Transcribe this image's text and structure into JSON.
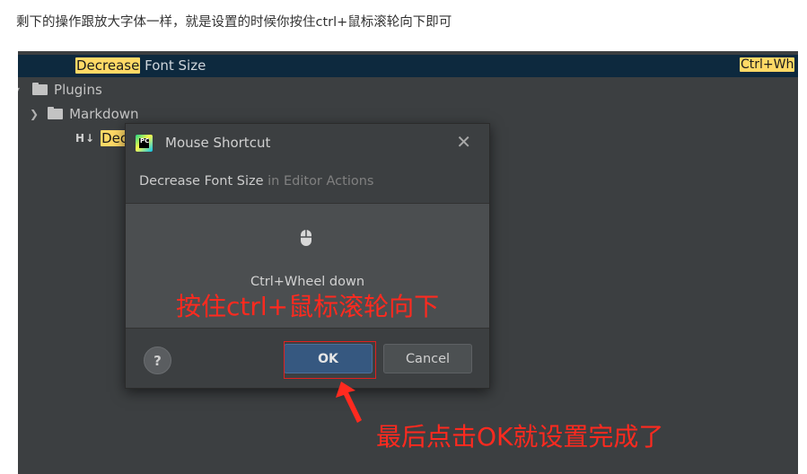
{
  "article": {
    "text": "剩下的操作跟放大字体一样，就是设置的时候你按住ctrl+鼠标滚轮向下即可"
  },
  "keymap": {
    "selected_highlight": "Decrease",
    "selected_rest": " Font Size",
    "selected_shortcut": "Ctrl+Wh",
    "plugins_label": "Plugins",
    "markdown_label": "Markdown",
    "md_child_highlight": "Dec",
    "md_icon_text": "H↓"
  },
  "dialog": {
    "title": "Mouse Shortcut",
    "action_name": "Decrease Font Size",
    "action_context": " in Editor Actions",
    "wheel_text": "Ctrl+Wheel down",
    "help_label": "?",
    "ok_label": "OK",
    "cancel_label": "Cancel",
    "app_icon_text": "PC"
  },
  "annotations": {
    "instruction": "按住ctrl+鼠标滚轮向下",
    "final_note": "最后点击OK就设置完成了"
  },
  "colors": {
    "ide_bg": "#3c3f41",
    "selection_bg": "#0d293e",
    "highlight": "#ffd966",
    "annotation_red": "#ff2a1f",
    "ok_button": "#365880"
  }
}
